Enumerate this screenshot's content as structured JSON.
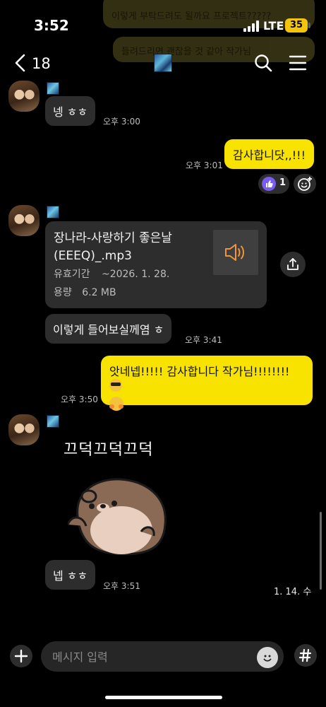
{
  "status_bar": {
    "time": "3:52",
    "network": "LTE",
    "battery": "35"
  },
  "ghost_messages": [
    "이렇게 부탁드려도 될까요 프로젝트?????",
    "들려드리면 괜찮을 것 같아 작가님"
  ],
  "header": {
    "back_count": "18"
  },
  "messages": {
    "m1": {
      "text": "넹 ㅎㅎ",
      "time": "오후 3:00"
    },
    "m2": {
      "text": "감사합니닷,,!!!",
      "time": "오후 3:01",
      "reaction_count": "1"
    },
    "file": {
      "name": "장나라-사랑하기 좋은날 (EEEQ)_.mp3",
      "expiry_label": "유효기간",
      "expiry_value": "~2026. 1. 28.",
      "size_label": "용량",
      "size_value": "6.2 MB"
    },
    "m3": {
      "text": "이렇게 들어보실께염 ㅎ",
      "time": "오후 3:41"
    },
    "m4": {
      "text": "앗네넵!!!!! 감사합니다 작가님!!!!!!!!",
      "time": "오후 3:50"
    },
    "sticker": {
      "caption": "끄덕끄덕끄덕"
    },
    "m5": {
      "text": "넵 ㅎㅎ",
      "time": "오후 3:51"
    }
  },
  "date_label": "1. 14. 수",
  "input": {
    "placeholder": "메시지 입력"
  },
  "colors": {
    "my_bubble": "#f8e300",
    "their_bubble": "#2d2d2d",
    "background": "#000000",
    "reaction_accent": "#7b5cf0"
  }
}
